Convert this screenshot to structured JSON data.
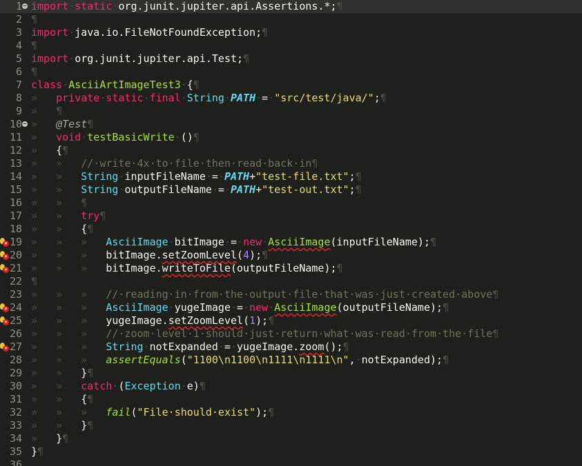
{
  "editor": {
    "language": "java",
    "file_class": "AsciiArtImageTest3",
    "current_line": 1,
    "lines": [
      {
        "n": "1",
        "fold": "minus",
        "tokens": [
          [
            "kw",
            "import"
          ],
          [
            "ws",
            "·"
          ],
          [
            "kw",
            "static"
          ],
          [
            "ws",
            "·"
          ],
          [
            "pl",
            "org.junit.jupiter.api.Assertions.*;"
          ],
          [
            "ws",
            "¶"
          ]
        ]
      },
      {
        "n": "2",
        "tokens": [
          [
            "ws",
            "¶"
          ]
        ]
      },
      {
        "n": "3",
        "tokens": [
          [
            "kw",
            "import"
          ],
          [
            "ws",
            "·"
          ],
          [
            "pl",
            "java.io.FileNotFoundException;"
          ],
          [
            "ws",
            "¶"
          ]
        ]
      },
      {
        "n": "4",
        "tokens": [
          [
            "ws",
            "¶"
          ]
        ]
      },
      {
        "n": "5",
        "tokens": [
          [
            "kw",
            "import"
          ],
          [
            "ws",
            "·"
          ],
          [
            "pl",
            "org.junit.jupiter.api.Test;"
          ],
          [
            "ws",
            "¶"
          ]
        ]
      },
      {
        "n": "6",
        "tokens": [
          [
            "ws",
            "¶"
          ]
        ]
      },
      {
        "n": "7",
        "tokens": [
          [
            "kw",
            "class"
          ],
          [
            "ws",
            "·"
          ],
          [
            "cl",
            "AsciiArtImageTest3"
          ],
          [
            "ws",
            "·"
          ],
          [
            "pl",
            "{"
          ],
          [
            "ws",
            "¶"
          ]
        ]
      },
      {
        "n": "8",
        "tokens": [
          [
            "ws",
            "»   "
          ],
          [
            "kw",
            "private"
          ],
          [
            "ws",
            "·"
          ],
          [
            "kw",
            "static"
          ],
          [
            "ws",
            "·"
          ],
          [
            "kw",
            "final"
          ],
          [
            "ws",
            "·"
          ],
          [
            "ty",
            "String"
          ],
          [
            "ws",
            "·"
          ],
          [
            "cn",
            "PATH"
          ],
          [
            "ws",
            "·"
          ],
          [
            "pl",
            "="
          ],
          [
            "ws",
            "·"
          ],
          [
            "st",
            "\"src/test/java/\""
          ],
          [
            "pl",
            ";"
          ],
          [
            "ws",
            "¶"
          ]
        ]
      },
      {
        "n": "9",
        "tokens": [
          [
            "ws",
            "»   ¶"
          ]
        ]
      },
      {
        "n": "10",
        "fold": "minus",
        "tokens": [
          [
            "ws",
            "»   "
          ],
          [
            "an",
            "@Test"
          ],
          [
            "ws",
            "¶"
          ]
        ]
      },
      {
        "n": "11",
        "tokens": [
          [
            "ws",
            "»   "
          ],
          [
            "kw",
            "void"
          ],
          [
            "ws",
            "·"
          ],
          [
            "cl",
            "testBasicWrite"
          ],
          [
            "ws",
            "·"
          ],
          [
            "pl",
            "()"
          ],
          [
            "ws",
            "¶"
          ]
        ]
      },
      {
        "n": "12",
        "tokens": [
          [
            "ws",
            "»   "
          ],
          [
            "pl",
            "{"
          ],
          [
            "ws",
            "¶"
          ]
        ]
      },
      {
        "n": "13",
        "tokens": [
          [
            "ws",
            "»   »   "
          ],
          [
            "cm",
            "//·write·4x·to·file·then·read·back·in"
          ],
          [
            "ws",
            "¶"
          ]
        ]
      },
      {
        "n": "14",
        "tokens": [
          [
            "ws",
            "»   »   "
          ],
          [
            "ty",
            "String"
          ],
          [
            "ws",
            "·"
          ],
          [
            "pl",
            "inputFileName"
          ],
          [
            "ws",
            "·"
          ],
          [
            "pl",
            "="
          ],
          [
            "ws",
            "·"
          ],
          [
            "cn",
            "PATH"
          ],
          [
            "pl",
            "+"
          ],
          [
            "st",
            "\"test-file.txt\""
          ],
          [
            "pl",
            ";"
          ],
          [
            "ws",
            "¶"
          ]
        ]
      },
      {
        "n": "15",
        "tokens": [
          [
            "ws",
            "»   »   "
          ],
          [
            "ty",
            "String"
          ],
          [
            "ws",
            "·"
          ],
          [
            "pl",
            "outputFileName"
          ],
          [
            "ws",
            "·"
          ],
          [
            "pl",
            "="
          ],
          [
            "ws",
            "·"
          ],
          [
            "cn",
            "PATH"
          ],
          [
            "pl",
            "+"
          ],
          [
            "st",
            "\"test-out.txt\""
          ],
          [
            "pl",
            ";"
          ],
          [
            "ws",
            "¶"
          ]
        ]
      },
      {
        "n": "16",
        "tokens": [
          [
            "ws",
            "»   »   ¶"
          ]
        ]
      },
      {
        "n": "17",
        "tokens": [
          [
            "ws",
            "»   »   "
          ],
          [
            "kw",
            "try"
          ],
          [
            "ws",
            "¶"
          ]
        ]
      },
      {
        "n": "18",
        "tokens": [
          [
            "ws",
            "»   »   "
          ],
          [
            "pl",
            "{"
          ],
          [
            "ws",
            "¶"
          ]
        ]
      },
      {
        "n": "19",
        "marker": true,
        "tokens": [
          [
            "ws",
            "»   »   »   "
          ],
          [
            "ty",
            "AsciiImage"
          ],
          [
            "ws",
            "·"
          ],
          [
            "pl",
            "bitImage"
          ],
          [
            "ws",
            "·"
          ],
          [
            "pl",
            "="
          ],
          [
            "ws",
            "·"
          ],
          [
            "kw",
            "new"
          ],
          [
            "ws",
            "·"
          ],
          [
            "cl u",
            "AsciiImage"
          ],
          [
            "pl",
            "(inputFileName);"
          ],
          [
            "ws",
            "¶"
          ]
        ]
      },
      {
        "n": "20",
        "marker": true,
        "tokens": [
          [
            "ws",
            "»   »   »   "
          ],
          [
            "pl",
            "bitImage."
          ],
          [
            "pl u",
            "setZoomLevel"
          ],
          [
            "pl",
            "("
          ],
          [
            "nm",
            "4"
          ],
          [
            "pl",
            ");"
          ],
          [
            "ws",
            "¶"
          ]
        ]
      },
      {
        "n": "21",
        "marker": true,
        "tokens": [
          [
            "ws",
            "»   »   »   "
          ],
          [
            "pl",
            "bitImage."
          ],
          [
            "pl u",
            "writeToFile"
          ],
          [
            "pl",
            "(outputFileName);"
          ],
          [
            "ws",
            "¶"
          ]
        ]
      },
      {
        "n": "22",
        "tokens": [
          [
            "ws",
            "¶"
          ]
        ]
      },
      {
        "n": "23",
        "tokens": [
          [
            "ws",
            "»   »   »   "
          ],
          [
            "cm",
            "//·reading·in·from·the·output·file·that·was·just·created·above"
          ],
          [
            "ws",
            "¶"
          ]
        ]
      },
      {
        "n": "24",
        "marker": true,
        "tokens": [
          [
            "ws",
            "»   »   »   "
          ],
          [
            "ty",
            "AsciiImage"
          ],
          [
            "ws",
            "·"
          ],
          [
            "pl",
            "yugeImage"
          ],
          [
            "ws",
            "·"
          ],
          [
            "pl",
            "="
          ],
          [
            "ws",
            "·"
          ],
          [
            "kw",
            "new"
          ],
          [
            "ws",
            "·"
          ],
          [
            "cl u",
            "AsciiImage"
          ],
          [
            "pl",
            "(outputFileName);"
          ],
          [
            "ws",
            "¶"
          ]
        ]
      },
      {
        "n": "25",
        "marker": true,
        "tokens": [
          [
            "ws",
            "»   »   »   "
          ],
          [
            "pl",
            "yugeImage."
          ],
          [
            "pl u",
            "setZoomLevel"
          ],
          [
            "pl",
            "("
          ],
          [
            "nm",
            "1"
          ],
          [
            "pl",
            ");"
          ],
          [
            "ws",
            "¶"
          ]
        ]
      },
      {
        "n": "26",
        "tokens": [
          [
            "ws",
            "»   »   »   "
          ],
          [
            "cm",
            "//·zoom·level·1·should·just·return·what·was·read·from·the·file"
          ],
          [
            "ws",
            "¶"
          ]
        ]
      },
      {
        "n": "27",
        "marker": true,
        "tokens": [
          [
            "ws",
            "»   »   »   "
          ],
          [
            "ty",
            "String"
          ],
          [
            "ws",
            "·"
          ],
          [
            "pl",
            "notExpanded"
          ],
          [
            "ws",
            "·"
          ],
          [
            "pl",
            "="
          ],
          [
            "ws",
            "·"
          ],
          [
            "pl",
            "yugeImage."
          ],
          [
            "pl u",
            "zoom"
          ],
          [
            "pl",
            "();"
          ],
          [
            "ws",
            "¶"
          ]
        ]
      },
      {
        "n": "28",
        "tokens": [
          [
            "ws",
            "»   »   »   "
          ],
          [
            "it",
            "assertEquals"
          ],
          [
            "pl",
            "("
          ],
          [
            "st",
            "\"1100\\n1100\\n1111\\n1111\\n\""
          ],
          [
            "pl",
            ","
          ],
          [
            "ws",
            "·"
          ],
          [
            "pl",
            "notExpanded);"
          ],
          [
            "ws",
            "¶"
          ]
        ]
      },
      {
        "n": "29",
        "tokens": [
          [
            "ws",
            "»   »   "
          ],
          [
            "pl",
            "}"
          ],
          [
            "ws",
            "¶"
          ]
        ]
      },
      {
        "n": "30",
        "tokens": [
          [
            "ws",
            "»   »   "
          ],
          [
            "kw",
            "catch"
          ],
          [
            "ws",
            "·"
          ],
          [
            "pl",
            "("
          ],
          [
            "ty",
            "Exception"
          ],
          [
            "ws",
            "·"
          ],
          [
            "pl",
            "e)"
          ],
          [
            "ws",
            "¶"
          ]
        ]
      },
      {
        "n": "31",
        "tokens": [
          [
            "ws",
            "»   »   "
          ],
          [
            "pl",
            "{"
          ],
          [
            "ws",
            "¶"
          ]
        ]
      },
      {
        "n": "32",
        "tokens": [
          [
            "ws",
            "»   »   »   "
          ],
          [
            "it",
            "fail"
          ],
          [
            "pl",
            "("
          ],
          [
            "st",
            "\"File·should·exist\""
          ],
          [
            "pl",
            ");"
          ],
          [
            "ws",
            "¶"
          ]
        ]
      },
      {
        "n": "33",
        "tokens": [
          [
            "ws",
            "»   »   "
          ],
          [
            "pl",
            "}"
          ],
          [
            "ws",
            "¶"
          ]
        ]
      },
      {
        "n": "34",
        "tokens": [
          [
            "ws",
            "»   "
          ],
          [
            "pl",
            "}"
          ],
          [
            "ws",
            "¶"
          ]
        ]
      },
      {
        "n": "35",
        "tokens": [
          [
            "pl",
            "}"
          ],
          [
            "ws",
            "¶"
          ]
        ]
      },
      {
        "n": "36",
        "tokens": []
      }
    ]
  },
  "colors": {
    "background": "#1f201c",
    "keyword": "#f92672",
    "type": "#66d9ef",
    "class_name": "#a6e22e",
    "string": "#e6db74",
    "comment": "#75715e",
    "whitespace_marker": "#4a4c44",
    "error_underline": "#e0262d"
  },
  "icons": {
    "fold": "fold-collapse-icon",
    "marker": "quickfix-error-icon"
  }
}
